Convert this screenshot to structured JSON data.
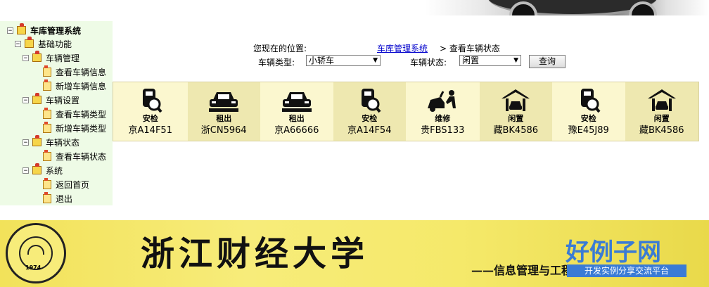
{
  "tree": {
    "root": "车库管理系统",
    "group": "基础功能",
    "items": [
      {
        "label": "车辆管理",
        "children": [
          "查看车辆信息",
          "新增车辆信息"
        ]
      },
      {
        "label": "车辆设置",
        "children": [
          "查看车辆类型",
          "新增车辆类型"
        ]
      },
      {
        "label": "车辆状态",
        "children": [
          "查看车辆状态"
        ]
      },
      {
        "label": "系统",
        "children": [
          "返回首页",
          "退出"
        ]
      }
    ]
  },
  "breadcrumb": {
    "label": "您现在的位置:",
    "link": "车库管理系统",
    "rest": "> 查看车辆状态"
  },
  "filter": {
    "type_label": "车辆类型:",
    "type_value": "小轿车",
    "status_label": "车辆状态:",
    "status_value": "闲置",
    "query_button": "查询"
  },
  "vehicles": [
    {
      "status": "安检",
      "plate": "京A14F51",
      "icon": "inspection-icon"
    },
    {
      "status": "租出",
      "plate": "浙CN5964",
      "icon": "car-icon"
    },
    {
      "status": "租出",
      "plate": "京A66666",
      "icon": "car-icon"
    },
    {
      "status": "安检",
      "plate": "京A14F54",
      "icon": "inspection-icon"
    },
    {
      "status": "维修",
      "plate": "贵FBS133",
      "icon": "repair-icon"
    },
    {
      "status": "闲置",
      "plate": "藏BK4586",
      "icon": "garage-icon"
    },
    {
      "status": "安检",
      "plate": "豫E45J89",
      "icon": "inspection-icon"
    },
    {
      "status": "闲置",
      "plate": "藏BK4586",
      "icon": "garage-icon"
    }
  ],
  "cell_backgrounds": [
    "#fbf7cf",
    "#eee8b0",
    "#fbf7cf",
    "#eee8b0",
    "#fbf7cf",
    "#eee8b0",
    "#fbf7cf",
    "#eee8b0"
  ],
  "banner": {
    "university": "浙江财经大学",
    "subtitle": "——信息管理与工程学院",
    "seal_year": "1974",
    "watermark_logo": "好例子网",
    "watermark_tag": "开发实例分享交流平台"
  }
}
